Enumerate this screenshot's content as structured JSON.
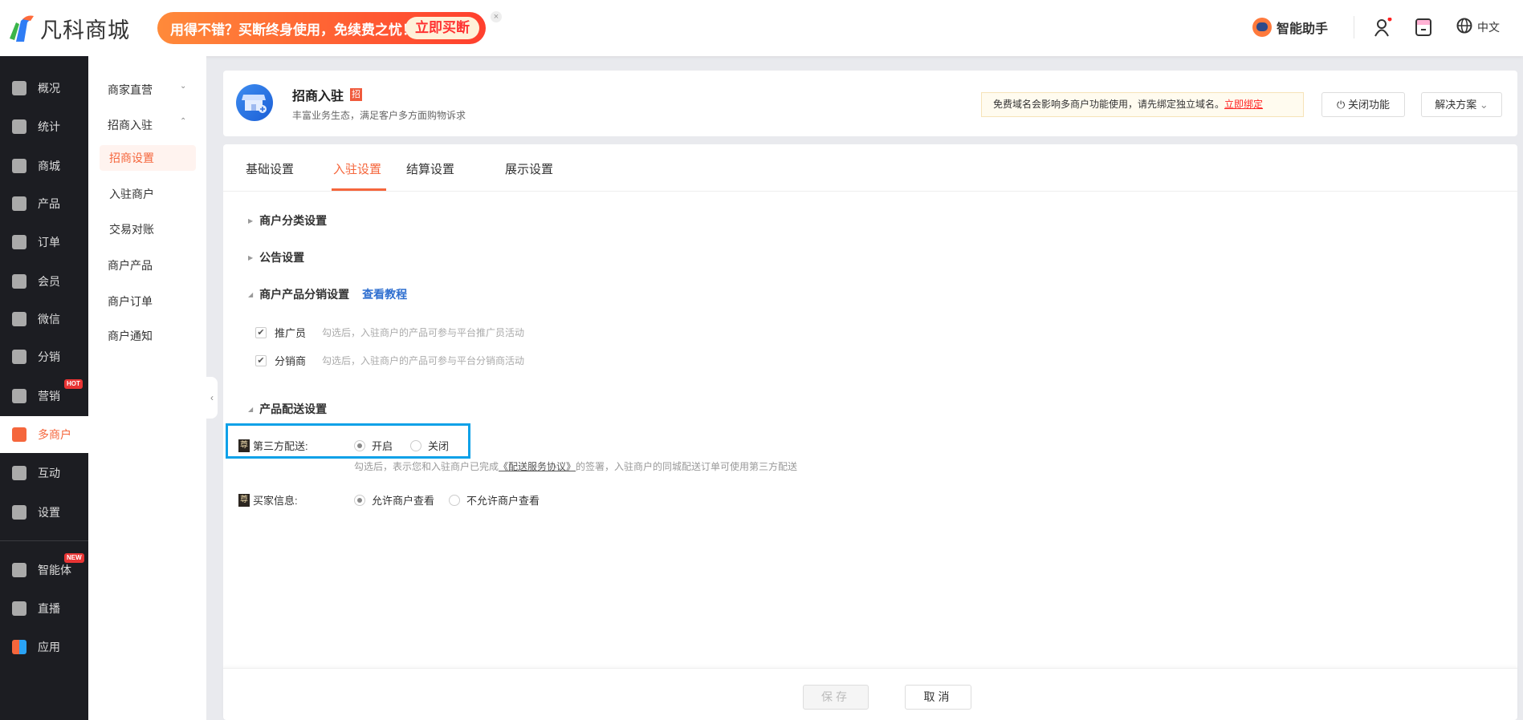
{
  "brand": {
    "name": "凡科商城"
  },
  "promo": {
    "text": "用得不错？买断终身使用，免续费之忧！",
    "button": "立即买断",
    "close": "×"
  },
  "topbar": {
    "assistant": "智能助手",
    "language": "中文"
  },
  "sidebar": {
    "items": [
      {
        "label": "概况",
        "icon": "layers-icon"
      },
      {
        "label": "统计",
        "icon": "chart-icon"
      },
      {
        "label": "商城",
        "icon": "shop-bag-icon"
      },
      {
        "label": "产品",
        "icon": "product-icon"
      },
      {
        "label": "订单",
        "icon": "order-icon"
      },
      {
        "label": "会员",
        "icon": "crown-icon"
      },
      {
        "label": "微信",
        "icon": "wechat-icon"
      },
      {
        "label": "分销",
        "icon": "users-icon"
      },
      {
        "label": "营销",
        "icon": "flag-icon",
        "badge": "HOT"
      },
      {
        "label": "多商户",
        "icon": "store-icon",
        "active": true
      },
      {
        "label": "互动",
        "icon": "interact-icon"
      },
      {
        "label": "设置",
        "icon": "gear-icon"
      },
      {
        "label": "智能体",
        "icon": "agent-icon",
        "badge": "NEW"
      },
      {
        "label": "直播",
        "icon": "tv-icon"
      },
      {
        "label": "应用",
        "icon": "apps-icon"
      }
    ]
  },
  "submenu": {
    "items": [
      {
        "label": "商家直营",
        "chevron": "⌄"
      },
      {
        "label": "招商入驻",
        "chevron": "⌃"
      },
      {
        "label": "招商设置",
        "selected": true
      },
      {
        "label": "入驻商户"
      },
      {
        "label": "交易对账"
      },
      {
        "label": "商户产品"
      },
      {
        "label": "商户订单"
      },
      {
        "label": "商户通知"
      }
    ]
  },
  "header": {
    "title": "招商入驻",
    "tag": "招",
    "subtitle": "丰富业务生态，满足客户多方面购物诉求",
    "notice": "免费域名会影响多商户功能使用，请先绑定独立域名。",
    "notice_link": "立即绑定",
    "close_feature": "关闭功能",
    "solutions": "解决方案"
  },
  "tabs": [
    {
      "label": "基础设置"
    },
    {
      "label": "入驻设置",
      "active": true
    },
    {
      "label": "结算设置"
    },
    {
      "label": "展示设置"
    }
  ],
  "sections": {
    "category": "商户分类设置",
    "announcement": "公告设置",
    "distribution": "商户产品分销设置",
    "tutorial": "查看教程",
    "promoter": {
      "label": "推广员",
      "hint": "勾选后，入驻商户的产品可参与平台推广员活动",
      "checked": true
    },
    "distributor": {
      "label": "分销商",
      "hint": "勾选后，入驻商户的产品可参与平台分销商活动",
      "checked": true
    },
    "delivery": "产品配送设置",
    "third_party": {
      "tag": "尊",
      "label": "第三方配送:",
      "on": "开启",
      "off": "关闭",
      "selected": "开启",
      "hint_pre": "勾选后，表示您和入驻商户已完成",
      "hint_link": "《配送服务协议》",
      "hint_post": "的签署，入驻商户的同城配送订单可使用第三方配送"
    },
    "buyer": {
      "tag": "尊",
      "label": "买家信息:",
      "allow": "允许商户查看",
      "deny": "不允许商户查看",
      "selected": "允许商户查看"
    }
  },
  "footer": {
    "save": "保存",
    "cancel": "取消"
  },
  "colors": {
    "accent": "#f5663c",
    "highlight": "#0ea1e8",
    "sidebar": "#1c1d22"
  }
}
